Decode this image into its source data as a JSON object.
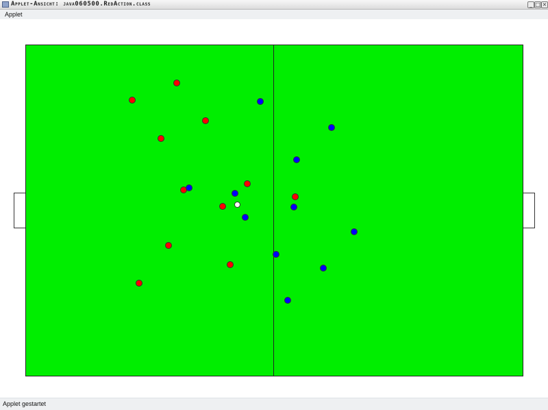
{
  "window": {
    "title": "Applet-Ansicht: java060500.RedAction.class",
    "icon": "applet-window-icon",
    "controls": [
      "minimize",
      "maximize",
      "close"
    ]
  },
  "menu": {
    "items": [
      "Applet"
    ]
  },
  "pitch": {
    "field_color": "#00ee00",
    "line_color": "#222222",
    "team_colors": {
      "red": "#ff0000",
      "blue": "#0000ff",
      "ball": "#ffffff"
    }
  },
  "status": {
    "text": "Applet gestartet"
  }
}
